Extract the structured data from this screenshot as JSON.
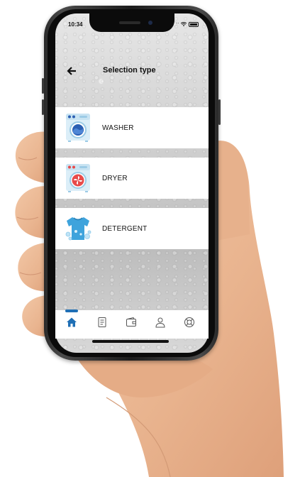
{
  "status_bar": {
    "time": "10:34"
  },
  "header": {
    "title": "Selection type"
  },
  "options": [
    {
      "label": "WASHER",
      "icon": "washer-icon"
    },
    {
      "label": "DRYER",
      "icon": "dryer-icon"
    },
    {
      "label": "DETERGENT",
      "icon": "detergent-shirt-icon"
    }
  ],
  "tabbar": {
    "items": [
      "home-icon",
      "document-icon",
      "wallet-icon",
      "profile-icon",
      "support-icon"
    ],
    "active": "home-icon"
  },
  "colors": {
    "accent": "#1f6fb5",
    "dryer_red": "#e84b4b",
    "washer_blue": "#2b5fb3",
    "shirt_blue": "#3ea3dc"
  }
}
